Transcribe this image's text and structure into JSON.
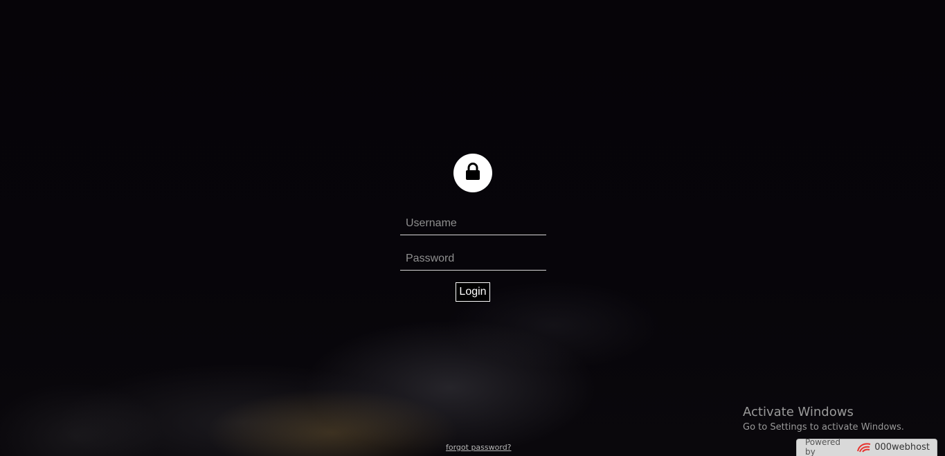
{
  "login_form": {
    "username_placeholder": "Username",
    "password_placeholder": "Password",
    "login_label": "Login",
    "forgot_label": "forgot password?",
    "lock_icon": "lock-icon"
  },
  "windows_watermark": {
    "title": "Activate Windows",
    "subtitle": "Go to Settings to activate Windows."
  },
  "host_badge": {
    "powered_by": "Powered by",
    "brand": "000webhost",
    "logo_icon": "000webhost-logo-icon",
    "logo_color": "#e8322e"
  },
  "colors": {
    "background": "#050307",
    "accent": "#ffffff"
  }
}
